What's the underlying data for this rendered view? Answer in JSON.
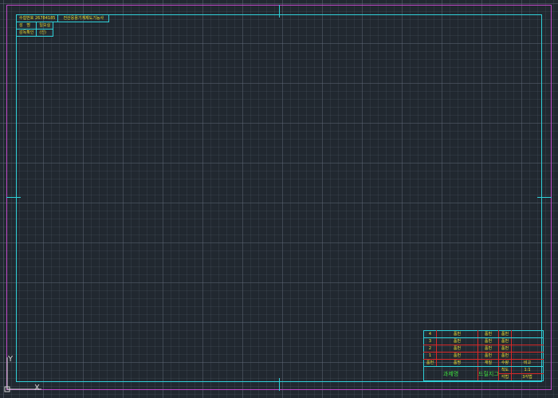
{
  "header_info": {
    "exam_number_label": "수험번호",
    "exam_number": "26784185",
    "exam_title": "전산응용기계제도기능사",
    "name_label_1": "성",
    "name_label_2": "명",
    "name_value": "일오실",
    "supervisor_label": "감독확인",
    "supervisor_value": "(인)"
  },
  "parts_list": {
    "rows": [
      {
        "no": "4",
        "name": "품번",
        "material": "품번",
        "qty": "품번",
        "note": ""
      },
      {
        "no": "3",
        "name": "품번",
        "material": "품번",
        "qty": "품번",
        "note": ""
      },
      {
        "no": "2",
        "name": "품번",
        "material": "품번",
        "qty": "품번",
        "note": ""
      },
      {
        "no": "1",
        "name": "품번",
        "material": "품번",
        "qty": "품번",
        "note": ""
      }
    ],
    "header": {
      "no": "품번",
      "name": "품명",
      "material": "재질",
      "qty": "수량",
      "note": "비고"
    }
  },
  "title_block": {
    "project_label": "과제명",
    "project_name": "드릴지그",
    "scale_label": "척도",
    "scale_value": "1:1",
    "projection_label": "각법",
    "projection_value": "3각법"
  },
  "ucs": {
    "x_label": "X",
    "y_label": "Y"
  },
  "colors": {
    "background": "#212830",
    "outer_border": "#c04ac8",
    "inner_border": "#2fd0d8",
    "title_lines": "#d82828",
    "text_yellow": "#f0e030",
    "text_green": "#40e040"
  }
}
